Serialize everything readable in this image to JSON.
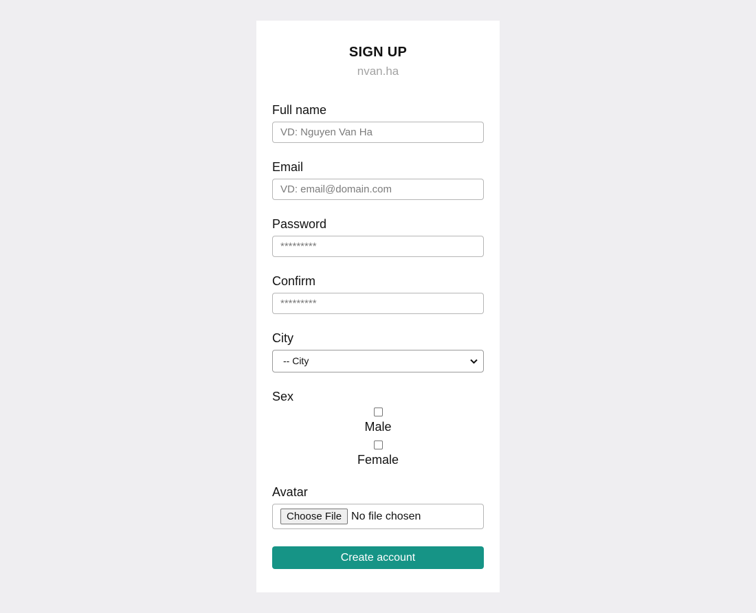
{
  "form": {
    "title": "SIGN UP",
    "subtitle": "nvan.ha",
    "fields": {
      "fullname": {
        "label": "Full name",
        "placeholder": "VD: Nguyen Van Ha",
        "value": ""
      },
      "email": {
        "label": "Email",
        "placeholder": "VD: email@domain.com",
        "value": ""
      },
      "password": {
        "label": "Password",
        "placeholder": "*********",
        "value": ""
      },
      "confirm": {
        "label": "Confirm",
        "placeholder": "*********",
        "value": ""
      },
      "city": {
        "label": "City",
        "selected": "-- City"
      },
      "sex": {
        "label": "Sex",
        "options": [
          {
            "label": "Male",
            "checked": false
          },
          {
            "label": "Female",
            "checked": false
          }
        ]
      },
      "avatar": {
        "label": "Avatar",
        "button_label": "Choose File",
        "status": "No file chosen"
      }
    },
    "submit_label": "Create account",
    "colors": {
      "background": "#efeef1",
      "card": "#ffffff",
      "accent": "#169486",
      "subtitle": "#a3a3a3"
    }
  }
}
